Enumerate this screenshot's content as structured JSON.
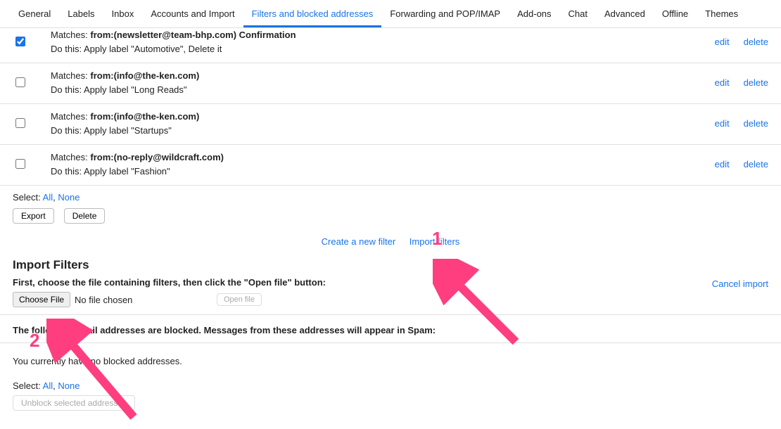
{
  "tabs": [
    {
      "label": "General"
    },
    {
      "label": "Labels"
    },
    {
      "label": "Inbox"
    },
    {
      "label": "Accounts and Import"
    },
    {
      "label": "Filters and blocked addresses",
      "active": true
    },
    {
      "label": "Forwarding and POP/IMAP"
    },
    {
      "label": "Add-ons"
    },
    {
      "label": "Chat"
    },
    {
      "label": "Advanced"
    },
    {
      "label": "Offline"
    },
    {
      "label": "Themes"
    }
  ],
  "labels": {
    "matches": "Matches:",
    "do_this": "Do this:",
    "edit": "edit",
    "delete": "delete",
    "select": "Select:",
    "all": "All",
    "none": "None",
    "comma": ",",
    "export": "Export",
    "delete_btn": "Delete",
    "create_new_filter": "Create a new filter",
    "import_filters": "Import filters",
    "import_title": "Import Filters",
    "import_instr": "First, choose the file containing filters, then click the \"Open file\" button:",
    "cancel_import": "Cancel import",
    "choose_file": "Choose File",
    "no_file": "No file chosen",
    "open_file": "Open file",
    "blocked_header": "The following email addresses are blocked. Messages from these addresses will appear in Spam:",
    "no_blocked": "You currently have no blocked addresses.",
    "unblock": "Unblock selected addresses"
  },
  "filters": [
    {
      "checked": true,
      "criteria": "from:(newsletter@team-bhp.com) Confirmation",
      "action": "Apply label \"Automotive\", Delete it"
    },
    {
      "checked": false,
      "criteria": "from:(info@the-ken.com)",
      "action": "Apply label \"Long Reads\""
    },
    {
      "checked": false,
      "criteria": "from:(info@the-ken.com)",
      "action": "Apply label \"Startups\""
    },
    {
      "checked": false,
      "criteria": "from:(no-reply@wildcraft.com)",
      "action": "Apply label \"Fashion\""
    }
  ],
  "annotations": {
    "num1": "1",
    "num2": "2"
  }
}
